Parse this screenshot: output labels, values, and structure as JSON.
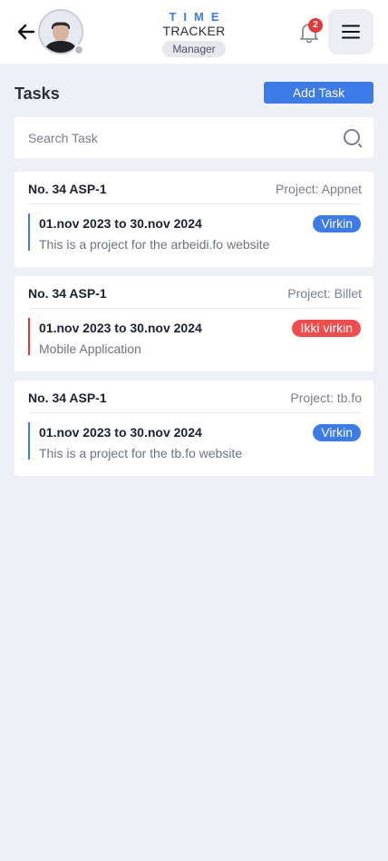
{
  "header": {
    "logo_top": "TIME",
    "logo_bottom": "TRACKER",
    "role": "Manager",
    "notification_count": "2"
  },
  "page": {
    "title": "Tasks",
    "add_button": "Add Task"
  },
  "search": {
    "placeholder": "Search Task",
    "value": ""
  },
  "tasks": [
    {
      "number": "No. 34  ASP-1",
      "project": "Project: Appnet",
      "dates": "01.nov 2023 to 30.nov 2024",
      "description": "This is a project for the arbeidi.fo website",
      "status": "Virkin"
    },
    {
      "number": "No. 34  ASP-1",
      "project": "Project: Billet",
      "dates": "01.nov 2023 to 30.nov 2024",
      "description": "Mobile Application",
      "status": "Ikki virkin"
    },
    {
      "number": "No. 34  ASP-1",
      "project": "Project: tb.fo",
      "dates": "01.nov 2023 to 30.nov 2024",
      "description": "This is a project for the tb.fo website",
      "status": "Virkin"
    }
  ],
  "colors": {
    "accent": "#3c7be8",
    "danger": "#ef4d4d",
    "background": "#eff0f5"
  },
  "icons": [
    "arrow-left-icon",
    "avatar",
    "bell-icon",
    "menu-icon",
    "search-icon"
  ]
}
